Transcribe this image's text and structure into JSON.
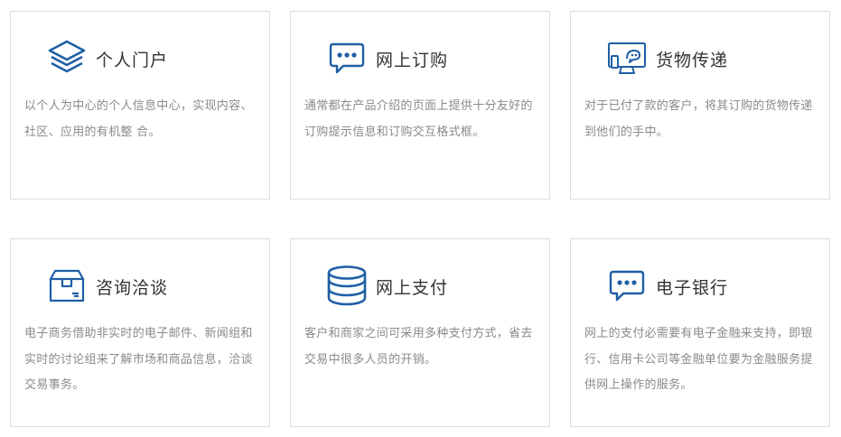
{
  "colors": {
    "icon_blue": "#1f5fa5",
    "border": "#dcdcdc",
    "title": "#333333",
    "desc": "#8a8a8a"
  },
  "cards": [
    {
      "title": "个人门户",
      "icon": "layers-icon",
      "desc": "以个人为中心的个人信息中心，实现内容、社区、应用的有机整 合。"
    },
    {
      "title": "网上订购",
      "icon": "chat-bubble-icon",
      "desc": "通常都在产品介绍的页面上提供十分友好的订购提示信息和订购交互格式框。"
    },
    {
      "title": "货物传递",
      "icon": "delivery-monitor-icon",
      "desc": "对于已付了款的客户，将其订购的货物传递到他们的手中。"
    },
    {
      "title": "咨询洽谈",
      "icon": "package-box-icon",
      "desc": "电子商务借助非实时的电子邮件、新闻组和实时的讨论组来了解市场和商品信息，洽谈交易事务。"
    },
    {
      "title": "网上支付",
      "icon": "database-stack-icon",
      "desc": "客户和商家之间可采用多种支付方式，省去交易中很多人员的开销。"
    },
    {
      "title": "电子银行",
      "icon": "chat-bubble-icon",
      "desc": "网上的支付必需要有电子金融来支持，即银行、信用卡公司等金融单位要为金融服务提供网上操作的服务。"
    }
  ]
}
